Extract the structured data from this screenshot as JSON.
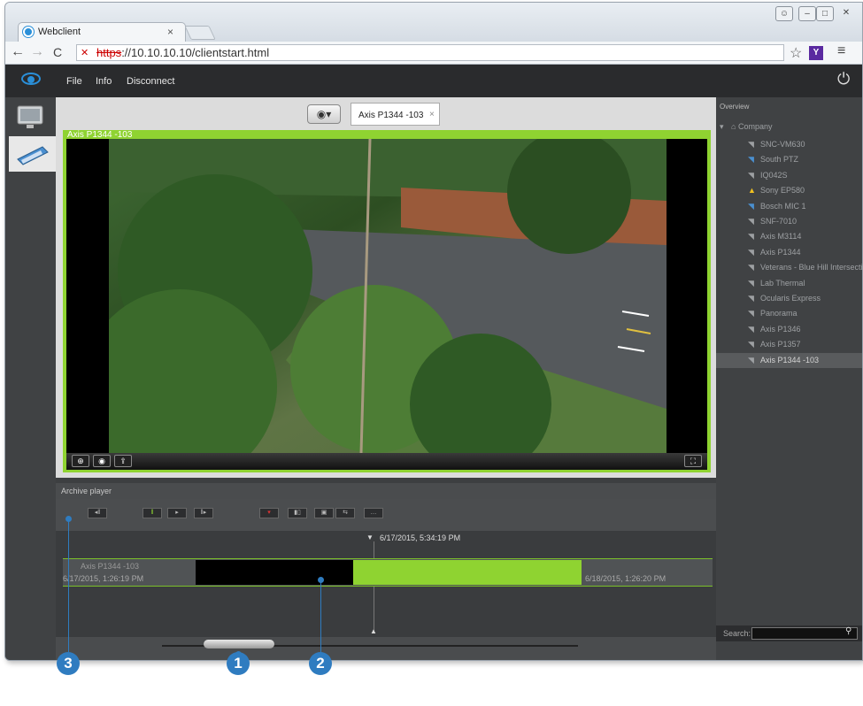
{
  "browser": {
    "tab_title": "Webclient",
    "tab_close": "×",
    "url_scheme": "https",
    "url_rest": "://10.10.10.10/clientstart.html",
    "badge": "Y"
  },
  "app": {
    "menu": [
      "File",
      "Info",
      "Disconnect"
    ],
    "view_tab_label": "Axis P1344 -103",
    "view_tab_close": "×",
    "video_title": "Axis P1344 -103"
  },
  "archive": {
    "title": "Archive player",
    "timeline_time": "6/17/2015, 5:34:19 PM",
    "row_camera": "Axis P1344 -103",
    "row_start": "6/17/2015, 1:26:19 PM",
    "row_end": "6/18/2015, 1:26:20 PM"
  },
  "overview": {
    "title": "Overview",
    "root": "Company",
    "cameras": [
      {
        "name": "SNC-VM630",
        "icon": "camera-icon",
        "color": "#9da0a3"
      },
      {
        "name": "South PTZ",
        "icon": "ptz-camera-icon",
        "color": "#4a90d0"
      },
      {
        "name": "IQ042S",
        "icon": "camera-icon",
        "color": "#9da0a3"
      },
      {
        "name": "Sony EP580",
        "icon": "warning-icon",
        "color": "#f0c020"
      },
      {
        "name": "Bosch MIC 1",
        "icon": "ptz-camera-icon",
        "color": "#4a90d0"
      },
      {
        "name": "SNF-7010",
        "icon": "camera-icon",
        "color": "#9da0a3"
      },
      {
        "name": "Axis M3114",
        "icon": "camera-icon",
        "color": "#9da0a3"
      },
      {
        "name": "Axis P1344",
        "icon": "camera-icon",
        "color": "#9da0a3"
      },
      {
        "name": "Veterans - Blue Hill Intersection",
        "icon": "camera-icon",
        "color": "#9da0a3"
      },
      {
        "name": "Lab Thermal",
        "icon": "camera-icon",
        "color": "#9da0a3"
      },
      {
        "name": "Ocularis Express",
        "icon": "camera-icon",
        "color": "#9da0a3"
      },
      {
        "name": "Panorama",
        "icon": "camera-icon",
        "color": "#9da0a3"
      },
      {
        "name": "Axis P1346",
        "icon": "camera-icon",
        "color": "#9da0a3"
      },
      {
        "name": "Axis P1357",
        "icon": "camera-icon",
        "color": "#9da0a3"
      },
      {
        "name": "Axis P1344 -103",
        "icon": "camera-icon",
        "color": "#9da0a3",
        "selected": true
      }
    ],
    "search_label": "Search:"
  },
  "callouts": [
    "1",
    "2",
    "3"
  ],
  "colors": {
    "accent": "#2f7cc0",
    "recording": "#8fd331"
  }
}
